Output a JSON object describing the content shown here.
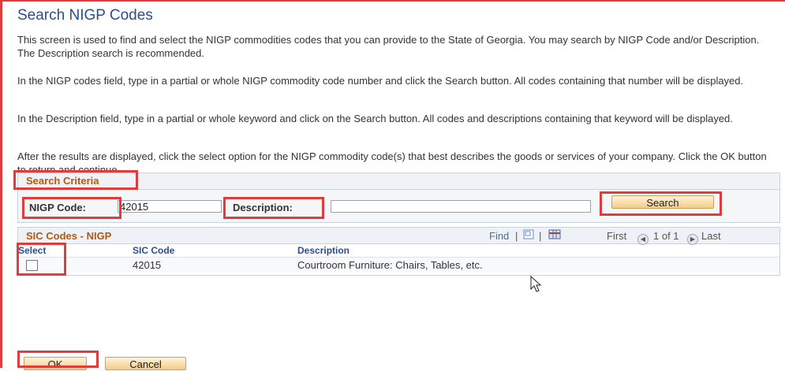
{
  "page": {
    "title": "Search NIGP Codes",
    "paragraphs": [
      "This screen is used to find and select the NIGP commodities codes that you can provide to the State of Georgia. You may search by NIGP Code and/or Description. The Description search is recommended.",
      "In the NIGP codes field, type in a partial or whole NIGP commodity code number and click the Search button. All codes containing that number will be displayed.",
      "In the Description field, type in a partial or whole keyword and click on the Search button. All codes and descriptions containing that keyword will be displayed.",
      "After the results are displayed, click the select option for the NIGP commodity code(s) that best describes the goods or services of your company. Click the OK button to return and continue."
    ]
  },
  "search_criteria": {
    "title": "Search Criteria",
    "nigp_label": "NIGP Code:",
    "nigp_value": "42015",
    "description_label": "Description:",
    "description_value": "",
    "search_button": "Search"
  },
  "grid": {
    "title": "SIC Codes - NIGP",
    "find": "Find",
    "separator": "|",
    "first": "First",
    "page_status": "1 of 1",
    "last": "Last",
    "columns": [
      "Select",
      "SIC Code",
      "Description"
    ],
    "rows": [
      {
        "selected": false,
        "sic_code": "42015",
        "description": "Courtroom Furniture: Chairs, Tables, etc."
      }
    ]
  },
  "footer": {
    "ok_button": "OK",
    "cancel_button": "Cancel"
  },
  "colors": {
    "title": "#2a4f8a",
    "section_title": "#b35a12",
    "highlight": "#e03c3c"
  }
}
